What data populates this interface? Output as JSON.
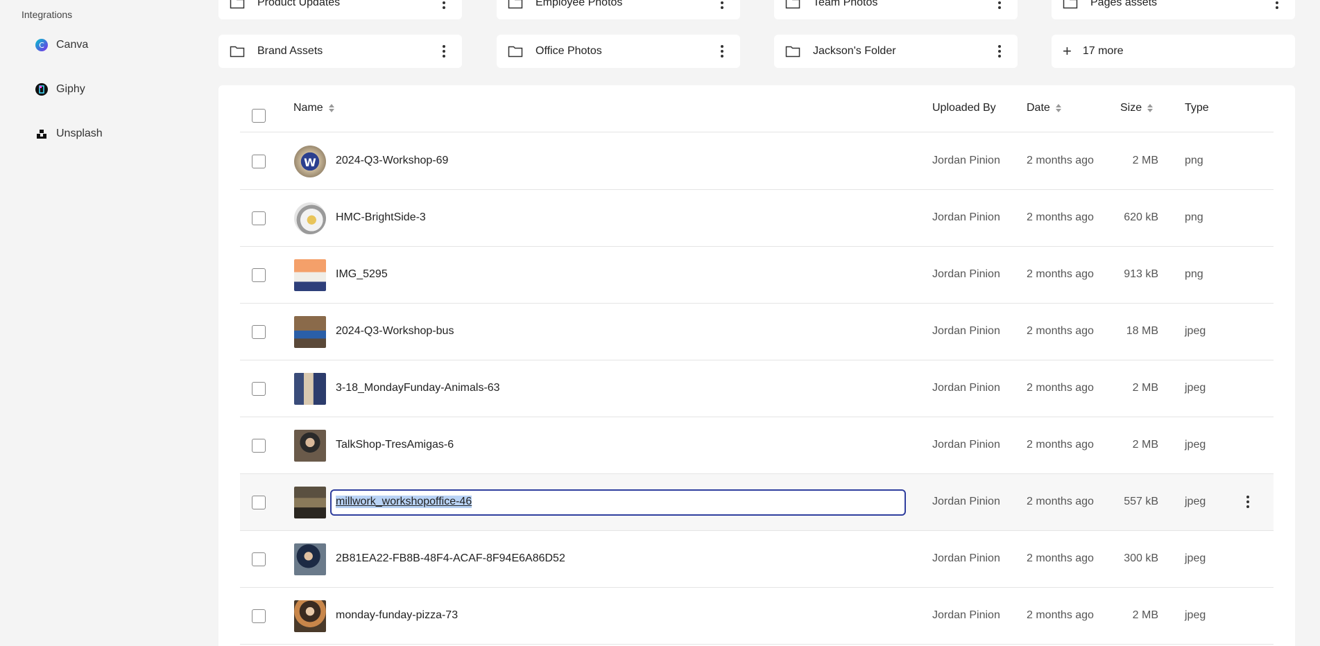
{
  "sidebar": {
    "heading": "Integrations",
    "items": [
      {
        "label": "Canva",
        "icon": "canva-icon"
      },
      {
        "label": "Giphy",
        "icon": "giphy-icon"
      },
      {
        "label": "Unsplash",
        "icon": "unsplash-icon"
      }
    ]
  },
  "folders": {
    "top": [
      "Product Updates",
      "Employee Photos",
      "Team Photos",
      "Pages assets"
    ],
    "second": [
      "Brand Assets",
      "Office Photos",
      "Jackson's Folder"
    ],
    "more_label": "17 more"
  },
  "table": {
    "headers": {
      "name": "Name",
      "uploaded_by": "Uploaded By",
      "date": "Date",
      "size": "Size",
      "type": "Type"
    },
    "rows": [
      {
        "name": "2024-Q3-Workshop-69",
        "uploader": "Jordan Pinion",
        "date": "2 months ago",
        "size": "2 MB",
        "type": "png"
      },
      {
        "name": "HMC-BrightSide-3",
        "uploader": "Jordan Pinion",
        "date": "2 months ago",
        "size": "620 kB",
        "type": "png"
      },
      {
        "name": "IMG_5295",
        "uploader": "Jordan Pinion",
        "date": "2 months ago",
        "size": "913 kB",
        "type": "png"
      },
      {
        "name": "2024-Q3-Workshop-bus",
        "uploader": "Jordan Pinion",
        "date": "2 months ago",
        "size": "18 MB",
        "type": "jpeg"
      },
      {
        "name": "3-18_MondayFunday-Animals-63",
        "uploader": "Jordan Pinion",
        "date": "2 months ago",
        "size": "2 MB",
        "type": "jpeg"
      },
      {
        "name": "TalkShop-TresAmigas-6",
        "uploader": "Jordan Pinion",
        "date": "2 months ago",
        "size": "2 MB",
        "type": "jpeg"
      },
      {
        "name": "millwork_workshopoffice-46",
        "uploader": "Jordan Pinion",
        "date": "2 months ago",
        "size": "557 kB",
        "type": "jpeg"
      },
      {
        "name": "2B81EA22-FB8B-48F4-ACAF-8F94E6A86D52",
        "uploader": "Jordan Pinion",
        "date": "2 months ago",
        "size": "300 kB",
        "type": "jpeg"
      },
      {
        "name": "monday-funday-pizza-73",
        "uploader": "Jordan Pinion",
        "date": "2 months ago",
        "size": "2 MB",
        "type": "jpeg"
      }
    ]
  },
  "colors": {
    "accent": "#2f3e9e",
    "selection": "#b9d3f5"
  }
}
